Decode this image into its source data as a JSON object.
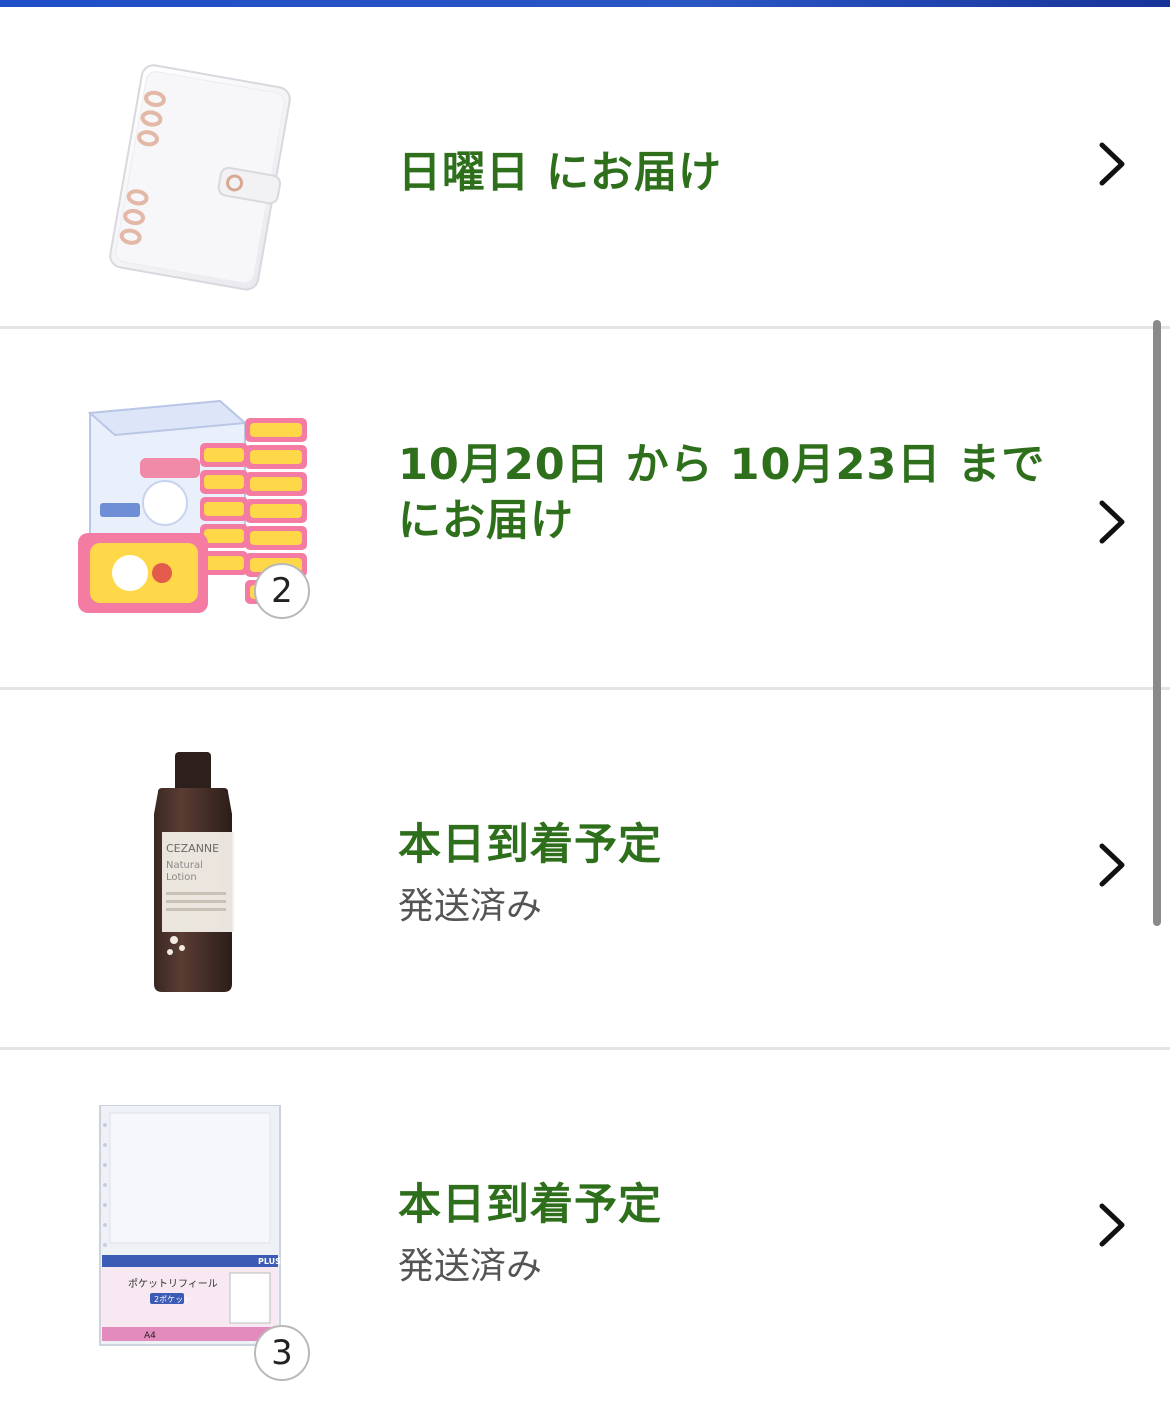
{
  "orders": [
    {
      "title": "日曜日 にお届け",
      "status": "",
      "quantity": "",
      "image_icon": "clear-binder-image"
    },
    {
      "title_line1": "10月20日 から 10月23日 まで",
      "title_line2": "にお届け",
      "status": "",
      "quantity": "2",
      "image_icon": "wet-wipes-box-image"
    },
    {
      "title": "本日到着予定",
      "status": "発送済み",
      "quantity": "",
      "image_icon": "lotion-bottle-image",
      "brand_text": "CEZANNE",
      "product_text": "Natural Lotion"
    },
    {
      "title": "本日到着予定",
      "status": "発送済み",
      "quantity": "3",
      "image_icon": "pocket-refill-image",
      "brand_text": "PLUS",
      "product_text": "ポケットリフィール",
      "sub_text": "2ポケット",
      "size_text": "A4"
    }
  ],
  "colors": {
    "accent_green": "#2e6f1c",
    "status_gray": "#555555",
    "top_bar_blue": "#1f4fc8"
  }
}
